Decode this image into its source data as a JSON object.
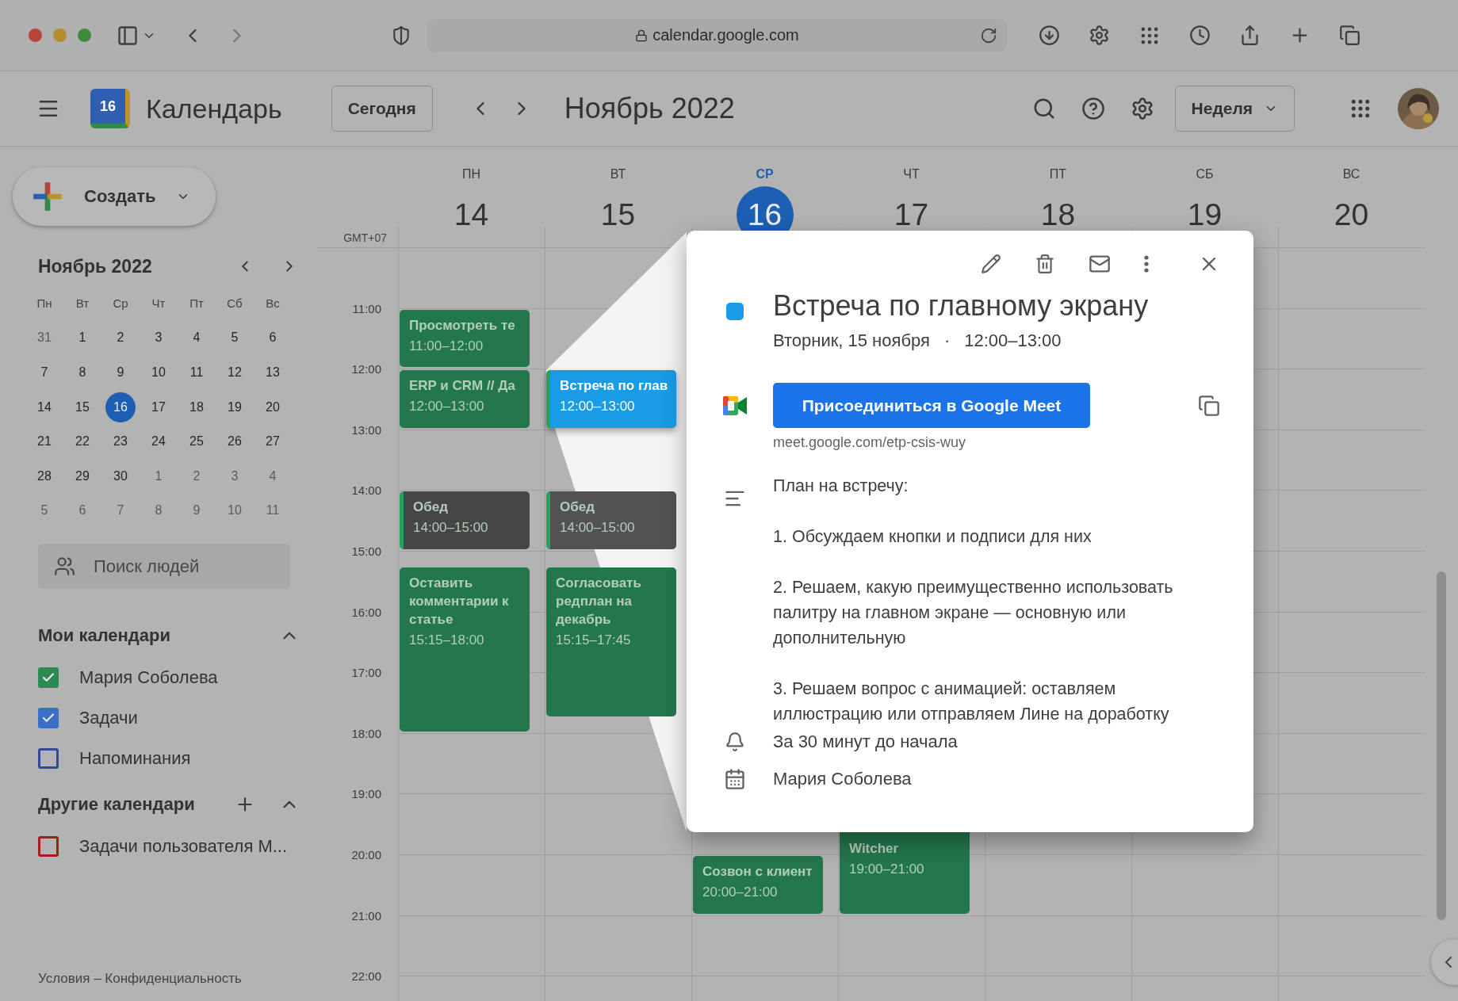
{
  "browser": {
    "url": "calendar.google.com"
  },
  "header": {
    "logo_day": "16",
    "app_title": "Календарь",
    "today_button": "Сегодня",
    "period": "Ноябрь 2022",
    "view": "Неделя"
  },
  "sidebar": {
    "create_button": "Создать",
    "mini_calendar": {
      "title": "Ноябрь 2022",
      "weekdays": [
        "Пн",
        "Вт",
        "Ср",
        "Чт",
        "Пт",
        "Сб",
        "Вс"
      ],
      "weeks": [
        [
          {
            "day": "31",
            "in_month": false,
            "selected": false
          },
          {
            "day": "1",
            "in_month": true,
            "selected": false
          },
          {
            "day": "2",
            "in_month": true,
            "selected": false
          },
          {
            "day": "3",
            "in_month": true,
            "selected": false
          },
          {
            "day": "4",
            "in_month": true,
            "selected": false
          },
          {
            "day": "5",
            "in_month": true,
            "selected": false
          },
          {
            "day": "6",
            "in_month": true,
            "selected": false
          }
        ],
        [
          {
            "day": "7",
            "in_month": true,
            "selected": false
          },
          {
            "day": "8",
            "in_month": true,
            "selected": false
          },
          {
            "day": "9",
            "in_month": true,
            "selected": false
          },
          {
            "day": "10",
            "in_month": true,
            "selected": false
          },
          {
            "day": "11",
            "in_month": true,
            "selected": false
          },
          {
            "day": "12",
            "in_month": true,
            "selected": false
          },
          {
            "day": "13",
            "in_month": true,
            "selected": false
          }
        ],
        [
          {
            "day": "14",
            "in_month": true,
            "selected": false
          },
          {
            "day": "15",
            "in_month": true,
            "selected": false
          },
          {
            "day": "16",
            "in_month": true,
            "selected": true
          },
          {
            "day": "17",
            "in_month": true,
            "selected": false
          },
          {
            "day": "18",
            "in_month": true,
            "selected": false
          },
          {
            "day": "19",
            "in_month": true,
            "selected": false
          },
          {
            "day": "20",
            "in_month": true,
            "selected": false
          }
        ],
        [
          {
            "day": "21",
            "in_month": true,
            "selected": false
          },
          {
            "day": "22",
            "in_month": true,
            "selected": false
          },
          {
            "day": "23",
            "in_month": true,
            "selected": false
          },
          {
            "day": "24",
            "in_month": true,
            "selected": false
          },
          {
            "day": "25",
            "in_month": true,
            "selected": false
          },
          {
            "day": "26",
            "in_month": true,
            "selected": false
          },
          {
            "day": "27",
            "in_month": true,
            "selected": false
          }
        ],
        [
          {
            "day": "28",
            "in_month": true,
            "selected": false
          },
          {
            "day": "29",
            "in_month": true,
            "selected": false
          },
          {
            "day": "30",
            "in_month": true,
            "selected": false
          },
          {
            "day": "1",
            "in_month": false,
            "selected": false
          },
          {
            "day": "2",
            "in_month": false,
            "selected": false
          },
          {
            "day": "3",
            "in_month": false,
            "selected": false
          },
          {
            "day": "4",
            "in_month": false,
            "selected": false
          }
        ],
        [
          {
            "day": "5",
            "in_month": false,
            "selected": false
          },
          {
            "day": "6",
            "in_month": false,
            "selected": false
          },
          {
            "day": "7",
            "in_month": false,
            "selected": false
          },
          {
            "day": "8",
            "in_month": false,
            "selected": false
          },
          {
            "day": "9",
            "in_month": false,
            "selected": false
          },
          {
            "day": "10",
            "in_month": false,
            "selected": false
          },
          {
            "day": "11",
            "in_month": false,
            "selected": false
          }
        ]
      ]
    },
    "people_search": {
      "placeholder": "Поиск людей"
    },
    "my_calendars": {
      "title": "Мои календари",
      "expanded": true,
      "items": [
        {
          "label": "Мария Соболева",
          "checked": true,
          "color": "#2a8a52"
        },
        {
          "label": "Задачи",
          "checked": true,
          "color": "#3b6fc6"
        },
        {
          "label": "Напоминания",
          "checked": false,
          "color": "#33489a"
        }
      ]
    },
    "other_calendars": {
      "title": "Другие календари",
      "expanded": true,
      "items": [
        {
          "label": "Задачи пользователя М...",
          "checked": false,
          "color": "#a31f1f"
        }
      ]
    },
    "footer": "Условия – Конфиденциальность"
  },
  "week": {
    "timezone": "GMT+07",
    "days": [
      {
        "weekday": "ПН",
        "date": "14",
        "selected": false,
        "events": [
          {
            "title": "Просмотреть те",
            "time": "11:00–12:00",
            "color": "#24774c",
            "kind": "plain",
            "selected": false
          },
          {
            "title": "ERP и CRM // Да",
            "time": "12:00–13:00",
            "color": "#24774c",
            "kind": "plain",
            "selected": false
          },
          {
            "title": "Обед",
            "time": "14:00–15:00",
            "color": "#464646",
            "kind": "striped",
            "selected": false
          },
          {
            "title": "Оставить комментарии к статье",
            "time": "15:15–18:00",
            "color": "#24774c",
            "kind": "plain",
            "selected": false
          }
        ]
      },
      {
        "weekday": "ВТ",
        "date": "15",
        "selected": false,
        "events": [
          {
            "title": "Встреча по глав",
            "time": "12:00–13:00",
            "color": "#1a9be6",
            "kind": "striped",
            "selected": true
          },
          {
            "title": "Обед",
            "time": "14:00–15:00",
            "color": "#525252",
            "kind": "striped",
            "selected": false
          },
          {
            "title": "Согласовать редплан на декабрь",
            "time": "15:15–17:45",
            "color": "#24774c",
            "kind": "plain",
            "selected": false
          }
        ]
      },
      {
        "weekday": "СР",
        "date": "16",
        "selected": true,
        "events": [
          {
            "title": "Созвон с клиент",
            "time": "20:00–21:00",
            "color": "#24774c",
            "kind": "plain",
            "selected": false
          }
        ]
      },
      {
        "weekday": "ЧТ",
        "date": "17",
        "selected": false,
        "events": [
          {
            "title": "Witcher",
            "time": "19:00–21:00",
            "color": "#24774c",
            "kind": "covered",
            "selected": false
          }
        ]
      },
      {
        "weekday": "ПТ",
        "date": "18",
        "selected": false
      },
      {
        "weekday": "СБ",
        "date": "19",
        "selected": false
      },
      {
        "weekday": "ВС",
        "date": "20",
        "selected": false
      }
    ],
    "hours": [
      "11:00",
      "12:00",
      "13:00",
      "14:00",
      "15:00",
      "16:00",
      "17:00",
      "18:00",
      "19:00",
      "20:00",
      "21:00",
      "22:00"
    ]
  },
  "popup": {
    "color": "#1a9be6",
    "title": "Встреча по главному экрану",
    "date": "Вторник, 15 ноября",
    "separator": "·",
    "time": "12:00–13:00",
    "meet_button": "Присоединиться в Google Meet",
    "meet_link": "meet.google.com/etp-csis-wuy",
    "description": [
      "План на встречу:",
      "1. Обсуждаем кнопки и подписи для них",
      "2. Решаем, какую преимущественно использовать палитру на главном экране — основную или дополнительную",
      "3. Решаем вопрос с анимацией: оставляем иллюстрацию или отправляем Лине на доработку"
    ],
    "reminder": "За 30 минут до начала",
    "calendar": "Мария Соболева"
  }
}
